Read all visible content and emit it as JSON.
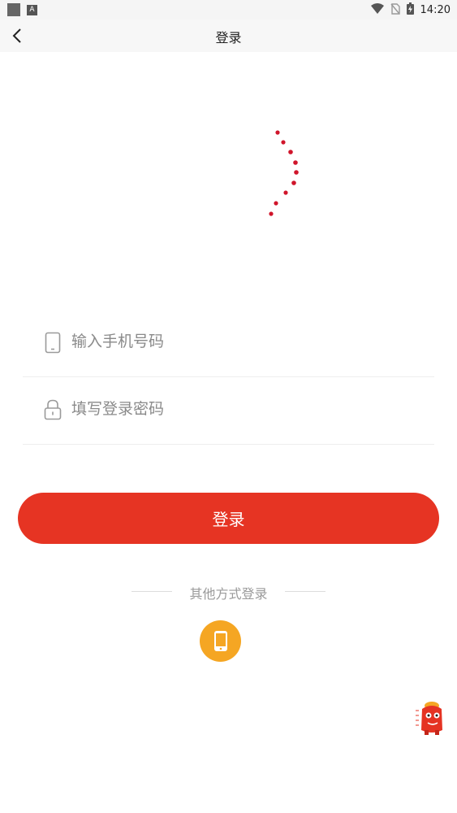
{
  "status_bar": {
    "time": "14:20",
    "left_icons": [
      "notification-square-icon",
      "a-app-icon"
    ],
    "right_icons": [
      "wifi-icon",
      "no-sim-icon",
      "battery-charging-icon"
    ]
  },
  "nav": {
    "title": "登录",
    "back_icon": "chevron-left-icon"
  },
  "logo": {
    "icon": "brand-striped-logo",
    "colors": [
      "#1b3c9e",
      "#d0152b"
    ]
  },
  "form": {
    "phone": {
      "placeholder": "输入手机号码",
      "value": "",
      "icon": "mobile-phone-icon"
    },
    "password": {
      "placeholder": "填写登录密码",
      "value": "",
      "icon": "lock-icon"
    }
  },
  "login_button": {
    "label": "登录",
    "color": "#e63423"
  },
  "other_login": {
    "label": "其他方式登录",
    "phone_button_icon": "mobile-phone-icon",
    "phone_button_color": "#f5a623"
  },
  "floating_mascot": {
    "icon": "red-mascot-icon"
  }
}
